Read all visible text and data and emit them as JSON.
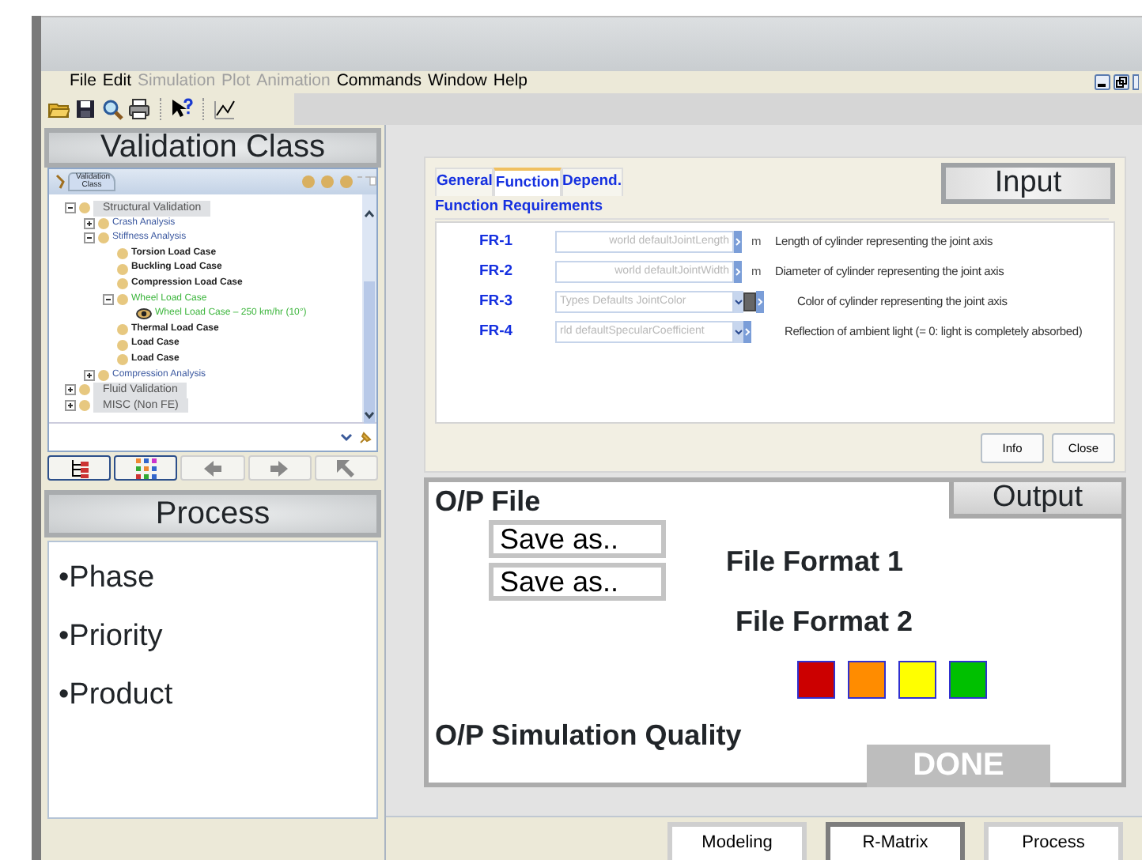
{
  "menu": [
    {
      "label": "File",
      "disabled": false
    },
    {
      "label": "Edit",
      "disabled": false
    },
    {
      "label": "Simulation",
      "disabled": true
    },
    {
      "label": "Plot",
      "disabled": true
    },
    {
      "label": "Animation",
      "disabled": true
    },
    {
      "label": "Commands",
      "disabled": false
    },
    {
      "label": "Window",
      "disabled": false
    },
    {
      "label": "Help",
      "disabled": false
    }
  ],
  "toolbar": [
    {
      "kind": "open"
    },
    {
      "kind": "save"
    },
    {
      "kind": "search"
    },
    {
      "kind": "print"
    },
    {
      "kind": "sep"
    },
    {
      "kind": "help"
    },
    {
      "kind": "sep"
    },
    {
      "kind": "chart"
    }
  ],
  "validation": {
    "header": "Validation Class",
    "tab": "Validation Class",
    "tree": [
      {
        "label": "Structural Validation",
        "kind": "group",
        "highlighted": false,
        "expanded": true,
        "children": [
          {
            "label": "Crash Analysis",
            "kind": "analysis",
            "highlighted": false,
            "expanded": false
          },
          {
            "label": "Stiffness Analysis",
            "kind": "analysis",
            "highlighted": false,
            "expanded": true,
            "children": [
              {
                "label": "Torsion Load Case",
                "kind": "case",
                "highlighted": false
              },
              {
                "label": "Buckling Load Case",
                "kind": "case",
                "highlighted": false
              },
              {
                "label": "Compression Load Case",
                "kind": "case",
                "highlighted": false
              },
              {
                "label": "Wheel Load Case",
                "kind": "case",
                "highlighted": true,
                "expanded": true,
                "children": [
                  {
                    "label": "Wheel Load Case – 250 km/hr (10°)",
                    "kind": "view",
                    "highlighted": true
                  }
                ]
              },
              {
                "label": "Thermal Load Case",
                "kind": "case",
                "highlighted": false
              },
              {
                "label": "Load Case",
                "kind": "case",
                "highlighted": false
              },
              {
                "label": "Load Case",
                "kind": "case",
                "highlighted": false
              }
            ]
          },
          {
            "label": "Compression Analysis",
            "kind": "analysis",
            "highlighted": false,
            "expanded": false
          }
        ]
      },
      {
        "label": "Fluid Validation",
        "kind": "group",
        "highlighted": false,
        "expanded": false
      },
      {
        "label": "MISC (Non FE)",
        "kind": "group",
        "highlighted": false,
        "expanded": false
      }
    ],
    "nav": [
      {
        "kind": "tree",
        "selected": true
      },
      {
        "kind": "grid",
        "selected": true
      },
      {
        "kind": "back",
        "selected": false
      },
      {
        "kind": "forward",
        "selected": false
      },
      {
        "kind": "up",
        "selected": false
      }
    ]
  },
  "process": {
    "header": "Process",
    "items": [
      "•Phase",
      "•Priority",
      "•Product"
    ]
  },
  "input": {
    "label": "Input",
    "tabs": [
      {
        "label": "General",
        "selected": false
      },
      {
        "label": "Function",
        "selected": true
      },
      {
        "label": "Depend.",
        "selected": false
      }
    ],
    "section": "Function Requirements",
    "rows": [
      {
        "id": "FR-1",
        "kind": "text",
        "value": "world defaultJointLength",
        "unit": "m",
        "description": "Length of cylinder representing the joint axis"
      },
      {
        "id": "FR-2",
        "kind": "text",
        "value": "world defaultJointWidth",
        "unit": "m",
        "description": "Diameter of cylinder representing the joint axis"
      },
      {
        "id": "FR-3",
        "kind": "color",
        "value": "Types Defaults JointColor",
        "description": "Color of cylinder representing the joint axis"
      },
      {
        "id": "FR-4",
        "kind": "combo",
        "value": "rld defaultSpecularCoefficient",
        "description": "Reflection of ambient light (= 0: light is completely absorbed)"
      }
    ],
    "buttons": [
      "Info",
      "Close"
    ]
  },
  "output": {
    "title": "O/P File",
    "label": "Output",
    "save_buttons": [
      "Save as..",
      "Save as.."
    ],
    "formats": [
      "File Format 1",
      "File Format 2"
    ],
    "quality_colors": [
      {
        "color": "#cc0000"
      },
      {
        "color": "#ff8c00"
      },
      {
        "color": "#ffff00"
      },
      {
        "color": "#00c000"
      }
    ],
    "quality_label": "O/P Simulation Quality",
    "done": {
      "label": "DONE",
      "disabled": true
    }
  },
  "bottom_tabs": [
    {
      "label": "Modeling",
      "selected": false
    },
    {
      "label": "R-Matrix",
      "selected": true
    },
    {
      "label": "Process",
      "selected": false
    }
  ]
}
